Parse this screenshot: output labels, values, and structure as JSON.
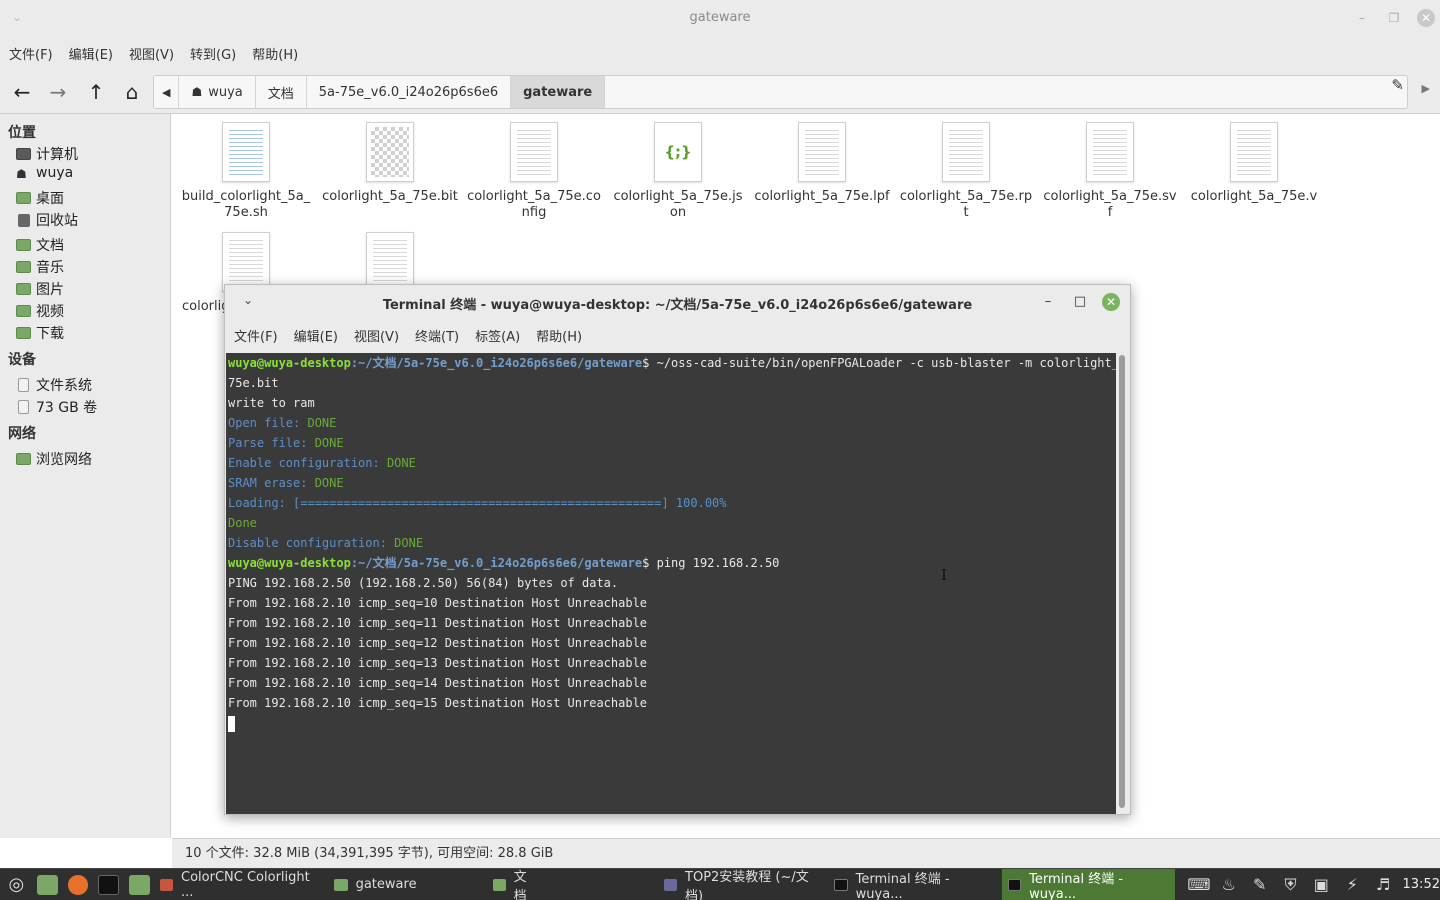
{
  "file_manager": {
    "title": "gateware",
    "menu": [
      "文件(F)",
      "编辑(E)",
      "视图(V)",
      "转到(G)",
      "帮助(H)"
    ],
    "breadcrumb": [
      "wuya",
      "文档",
      "5a-75e_v6.0_i24o26p6s6e6",
      "gateware"
    ],
    "sidebar": {
      "places_header": "位置",
      "places": [
        "计算机",
        "wuya",
        "桌面",
        "回收站",
        "文档",
        "音乐",
        "图片",
        "视频",
        "下载"
      ],
      "devices_header": "设备",
      "devices": [
        "文件系统",
        "73 GB 卷"
      ],
      "network_header": "网络",
      "network": [
        "浏览网络"
      ]
    },
    "files": [
      {
        "name": "build_colorlight_5a_75e.sh",
        "icon": "script-icon"
      },
      {
        "name": "colorlight_5a_75e.bit",
        "icon": "binary-icon"
      },
      {
        "name": "colorlight_5a_75e.config",
        "icon": "text-icon"
      },
      {
        "name": "colorlight_5a_75e.json",
        "icon": "json-icon",
        "glyph": "{;}"
      },
      {
        "name": "colorlight_5a_75e.lpf",
        "icon": "text-icon"
      },
      {
        "name": "colorlight_5a_75e.rpt",
        "icon": "text-icon"
      },
      {
        "name": "colorlight_5a_75e.svf",
        "icon": "text-icon"
      },
      {
        "name": "colorlight_5a_75e.v",
        "icon": "text-icon"
      },
      {
        "name": "colorlig",
        "icon": "text-icon"
      },
      {
        "name": "",
        "icon": "text-icon"
      }
    ],
    "status": "10 个文件: 32.8 MiB (34,391,395 字节), 可用空间: 28.8 GiB"
  },
  "terminal": {
    "title": "Terminal 终端 - wuya@wuya-desktop: ~/文档/5a-75e_v6.0_i24o26p6s6e6/gateware",
    "menu": [
      "文件(F)",
      "编辑(E)",
      "视图(V)",
      "终端(T)",
      "标签(A)",
      "帮助(H)"
    ],
    "prompt_user": "wuya@wuya-desktop",
    "prompt_path": ":~/文档/5a-75e_v6.0_i24o26p6s6e6/gateware",
    "cmd1": "$ ~/oss-cad-suite/bin/openFPGALoader -c usb-blaster -m colorlight_5a_",
    "cmd1_wrap": "75e.bit",
    "write_ram": "write to ram",
    "open_label": "Open file: ",
    "parse_label": "Parse file: ",
    "enable_label": "Enable configuration: ",
    "sram_label": "SRAM erase: ",
    "done": "DONE",
    "loading": "Loading: [==================================================] 100.00%",
    "done_word": "Done",
    "disable_label": "Disable configuration: ",
    "cmd2": "$ ping 192.168.2.50",
    "ping_header": "PING 192.168.2.50 (192.168.2.50) 56(84) bytes of data.",
    "ping_lines": [
      "From 192.168.2.10 icmp_seq=10 Destination Host Unreachable",
      "From 192.168.2.10 icmp_seq=11 Destination Host Unreachable",
      "From 192.168.2.10 icmp_seq=12 Destination Host Unreachable",
      "From 192.168.2.10 icmp_seq=13 Destination Host Unreachable",
      "From 192.168.2.10 icmp_seq=14 Destination Host Unreachable",
      "From 192.168.2.10 icmp_seq=15 Destination Host Unreachable"
    ]
  },
  "taskbar": {
    "items": [
      {
        "label": "ColorCNC Colorlight ...",
        "color": "#c8553d"
      },
      {
        "label": "gateware",
        "color": "#7ba866"
      },
      {
        "label": "文档",
        "color": "#7ba866"
      },
      {
        "label": "TOP2安装教程 (~/文档)",
        "color": "#6a6a9a"
      },
      {
        "label": "Terminal 终端 - wuya...",
        "color": "#222222"
      },
      {
        "label": "Terminal 终端 - wuya...",
        "color": "#222222"
      }
    ],
    "clock": "13:52"
  },
  "colors": {
    "accent": "#4c7a34",
    "terminal_bg": "#3a3a3a",
    "prompt_user": "#8ae234",
    "prompt_path": "#729fcf"
  }
}
